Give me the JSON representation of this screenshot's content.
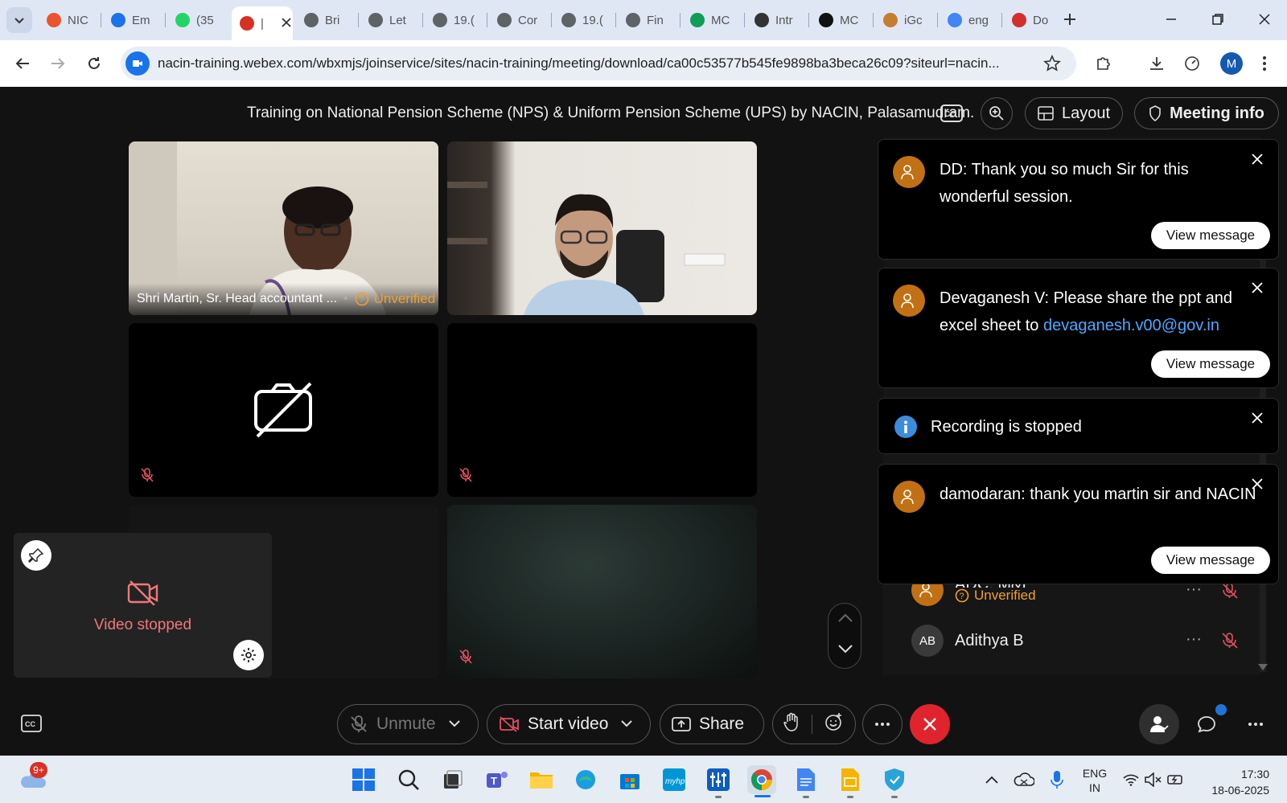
{
  "browser": {
    "tabs": [
      {
        "label": "NIC",
        "icon": "nic-icon",
        "color": "#e8552e"
      },
      {
        "label": "Em",
        "icon": "at-icon",
        "color": "#1a73e8"
      },
      {
        "label": "(35",
        "icon": "whatsapp-icon",
        "color": "#25d366"
      },
      {
        "label": "|",
        "icon": "record-icon",
        "color": "#d93025",
        "active": true
      },
      {
        "label": "Bri",
        "icon": "globe-icon",
        "color": "#5f6368"
      },
      {
        "label": "Let",
        "icon": "globe-icon",
        "color": "#5f6368"
      },
      {
        "label": "19.(",
        "icon": "globe-icon",
        "color": "#5f6368"
      },
      {
        "label": "Cor",
        "icon": "globe-icon",
        "color": "#5f6368"
      },
      {
        "label": "19.(",
        "icon": "globe-icon",
        "color": "#5f6368"
      },
      {
        "label": "Fin",
        "icon": "globe-icon",
        "color": "#5f6368"
      },
      {
        "label": "MC",
        "icon": "sheets-icon",
        "color": "#0f9d58"
      },
      {
        "label": "Intr",
        "icon": "openai-icon",
        "color": "#333"
      },
      {
        "label": "MC",
        "icon": "openai-icon",
        "color": "#111"
      },
      {
        "label": "iGc",
        "icon": "igot-icon",
        "color": "#c77d2e"
      },
      {
        "label": "eng",
        "icon": "google-icon",
        "color": "#4285f4"
      },
      {
        "label": "Do",
        "icon": "heart-icon",
        "color": "#d32f2f"
      }
    ],
    "url": "nacin-training.webex.com/wbxmjs/joinservice/sites/nacin-training/meeting/download/ca00c53577b545fe9898ba3beca26c09?siteurl=nacin...",
    "profile_initial": "M"
  },
  "meeting": {
    "title": "Training on National Pension Scheme (NPS) & Uniform Pension Scheme (UPS) by NACIN, Palasamudram.",
    "layout_label": "Layout",
    "meeting_info_label": "Meeting info",
    "tile1_name": "Shri Martin, Sr. Head accountant ...",
    "unverified": "Unverified",
    "self_view_status": "Video stopped"
  },
  "participants": [
    {
      "initials": "",
      "name": "ADC, M&I",
      "status": "Unverified"
    },
    {
      "initials": "AB",
      "name": "Adithya B",
      "status": ""
    }
  ],
  "toasts": [
    {
      "text": "DD: Thank you so much Sir for this wonderful session.",
      "action": "View message"
    },
    {
      "text_prefix": "Devaganesh V: Please share the ppt and excel sheet to ",
      "link": "devaganesh.v00@gov.in",
      "action": "View message"
    },
    {
      "text": "Recording is stopped"
    },
    {
      "text": "damodaran: thank you martin sir and NACIN",
      "action": "View message"
    }
  ],
  "controls": {
    "unmute": "Unmute",
    "start_video": "Start video",
    "share": "Share"
  },
  "taskbar": {
    "notification_badge": "9+",
    "lang_top": "ENG",
    "lang_bottom": "IN",
    "time": "17:30",
    "date": "18-06-2025"
  },
  "colors": {
    "end_call": "#e0242e",
    "accent": "#4ba8ff",
    "warning": "#f0a030"
  }
}
